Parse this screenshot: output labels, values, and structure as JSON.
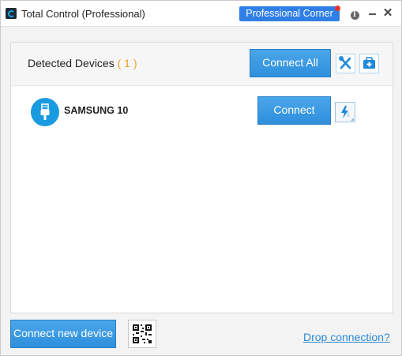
{
  "window": {
    "title": "Total Control (Professional)",
    "icons": {
      "app": "app-logo-icon",
      "info": "info-icon",
      "minimize": "minimize-icon",
      "close": "close-icon"
    },
    "professional_corner_label": "Professional Corner",
    "info_glyph": "i",
    "close_glyph": "✕"
  },
  "devices_panel": {
    "title": "Detected Devices",
    "count_text": "( 1 )",
    "connect_all_label": "Connect All",
    "tool_icons": [
      "wrench-icon",
      "toolkit-icon"
    ],
    "devices": [
      {
        "name": "SAMSUNG 10",
        "icon": "usb-icon",
        "connect_label": "Connect",
        "action_icon": "flash-icon"
      }
    ]
  },
  "footer": {
    "connect_new_label": "Connect new device",
    "qr_icon": "qr-code-icon",
    "drop_connection_label": "Drop connection?"
  },
  "colors": {
    "accent_blue": "#2f8fdc",
    "professional_corner": "#2f7fe6",
    "notification_dot": "#e8322a",
    "count_orange": "#f0a020",
    "link_blue": "#2b8ad8"
  }
}
